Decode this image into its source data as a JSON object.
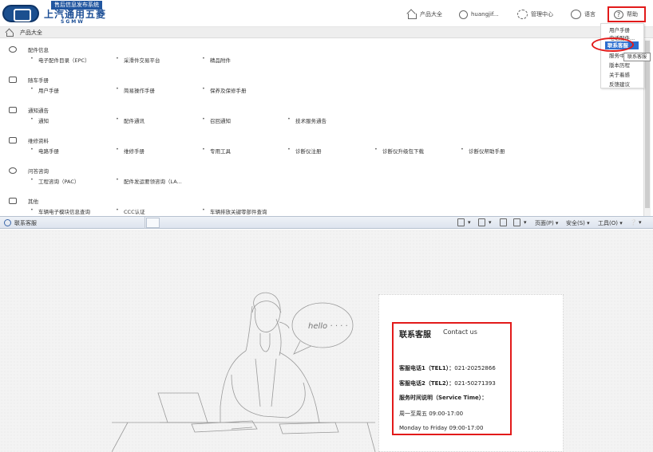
{
  "header": {
    "logo": {
      "tag": "售后信息发布系统",
      "name_cn": "上汽通用五菱",
      "name_en": "SGMW"
    },
    "nav": {
      "products": "产品大全",
      "user": "huangjif...",
      "admin": "管理中心",
      "language": "语言",
      "help": "帮助"
    }
  },
  "help_menu": {
    "items": [
      "用户手册",
      "电话配件...",
      "联系客服",
      "服务中心",
      "版本历程",
      "关于着感",
      "反馈建议"
    ],
    "active_index": 2,
    "tooltip": "联系客服"
  },
  "breadcrumb": {
    "label": "产品大全"
  },
  "catalog": {
    "sections": [
      {
        "title": "配件信息",
        "icon": "gear-icon",
        "links": [
          "电子配件目录（EPC）",
          "采滑件交易平台",
          "精品附件"
        ]
      },
      {
        "title": "随车手册",
        "icon": "book-icon",
        "links": [
          "用户手册",
          "简易操作手册",
          "保养及保修手册"
        ]
      },
      {
        "title": "通知通告",
        "icon": "speaker-icon",
        "links": [
          "通知",
          "配件通讯",
          "召回通知",
          "技术服务通告"
        ]
      },
      {
        "title": "维修资料",
        "icon": "wrench-icon",
        "links": [
          "电路手册",
          "维修手册",
          "专用工具",
          "诊断仪注册",
          "诊断仪升级包下载",
          "诊断仪帮助手册"
        ]
      },
      {
        "title": "问答咨询",
        "icon": "chat-icon",
        "links": [
          "工程咨询（PAC）",
          "配件发运要领咨询（LA..."
        ]
      },
      {
        "title": "其他",
        "icon": "document-icon",
        "links": [
          "车辆电子模块信息查询",
          "CCC认证",
          "车辆排放关键零部件查询"
        ]
      }
    ]
  },
  "browser_toolbar": {
    "tab_title": "联系客服",
    "page_menu": "页面(P) ▾",
    "safety_menu": "安全(S) ▾",
    "tools_menu": "工具(O) ▾",
    "help_menu": "❔ ▾"
  },
  "illustration": {
    "bubble_text": "hello · · · ·"
  },
  "contact": {
    "title": "联系客服",
    "subtitle": "Contact us",
    "tel1_label": "客服电话1（TEL1）：",
    "tel1_value": "021-20252866",
    "tel2_label": "客服电话2（TEL2）：",
    "tel2_value": "021-50271393",
    "hours_label": "服务时间说明（Service Time）：",
    "hours_cn": "周一至周五 09:00-17:00",
    "hours_en": "Monday to Friday 09:00-17:00"
  },
  "colors": {
    "highlight": "#e21a1a",
    "menu_active": "#2b6ecf",
    "brand": "#1d4f96"
  }
}
